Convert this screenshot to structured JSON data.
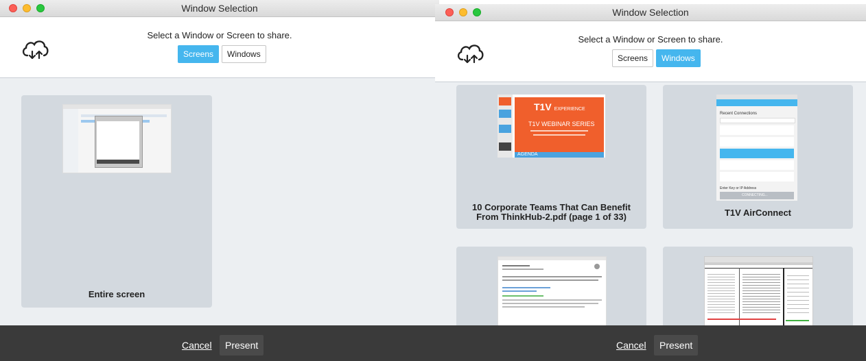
{
  "left_window": {
    "title": "Window Selection",
    "prompt": "Select a Window or Screen to share.",
    "tabs": [
      {
        "label": "Screens",
        "active": true
      },
      {
        "label": "Windows",
        "active": false
      }
    ],
    "tiles": [
      {
        "label": "Entire screen"
      }
    ],
    "footer": {
      "cancel_label": "Cancel",
      "present_label": "Present"
    }
  },
  "right_window": {
    "title": "Window Selection",
    "prompt": "Select a Window or Screen to share.",
    "tabs": [
      {
        "label": "Screens",
        "active": false
      },
      {
        "label": "Windows",
        "active": true
      }
    ],
    "tiles": [
      {
        "label": "10 Corporate Teams That Can Benefit From ThinkHub-2.pdf (page 1 of 33)"
      },
      {
        "label": "T1V AirConnect"
      },
      {
        "label": ""
      },
      {
        "label": ""
      }
    ],
    "thumbnail_text": {
      "pdf_brand": "T1V",
      "pdf_brand_sub": "EXPERIENCE",
      "pdf_series": "T1V WEBINAR SERIES",
      "pdf_agenda": "AGENDA",
      "app_subtitle": "Recent Connections",
      "app_ip_label": "Enter Key or IP Address",
      "app_button": "CONNECTING..."
    },
    "footer": {
      "cancel_label": "Cancel",
      "present_label": "Present"
    }
  },
  "colors": {
    "accent": "#45b6ee",
    "footer_bg": "#3a3a3a",
    "tile_bg": "#d3d9df",
    "pdf_orange": "#f05f2c"
  },
  "icons": [
    "cloud-sync-icon",
    "close-light-icon",
    "minimize-light-icon",
    "zoom-light-icon"
  ]
}
